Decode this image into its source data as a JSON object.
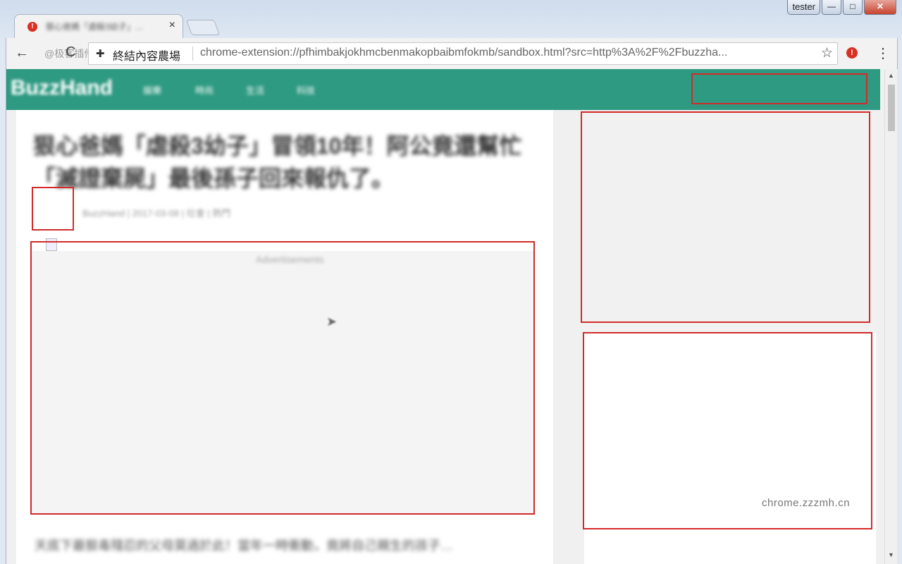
{
  "window": {
    "user_button": "tester",
    "minimize": "—",
    "maximize": "□",
    "close": "✕"
  },
  "tab": {
    "title": "狠心爸媽「虐殺3幼子」…",
    "close": "×",
    "warning_icon": "!"
  },
  "toolbar": {
    "back": "←",
    "reload": "C",
    "watermark": "@极客插件",
    "extension_icon": "puzzle-piece",
    "extension_name": "終結內容農場",
    "url": "chrome-extension://pfhimbakjokhmcbenmakopbaibmfokmb/sandbox.html?src=http%3A%2F%2Fbuzzha...",
    "star": "☆",
    "warning_icon": "!",
    "menu": "⋮"
  },
  "page": {
    "logo": "BuzzHand",
    "nav": [
      "娛樂",
      "時尚",
      "生活",
      "科技"
    ],
    "headline": "狠心爸媽「虐殺3幼子」冒領10年！阿公竟還幫忙「滅證棄屍」最後孫子回來報仇了。",
    "meta": "BuzzHand  |  2017-03-08  |  社會  |  熱門",
    "ad_label": "Advertisements",
    "body_text": "天底下最狠毒殘忍的父母莫過於此！當年一時衝動，竟將自己親生的孩子…",
    "watermark": "chrome.zzzmh.cn"
  },
  "colors": {
    "site_bar": "#2f9a82",
    "highlight": "#d22a2a"
  }
}
